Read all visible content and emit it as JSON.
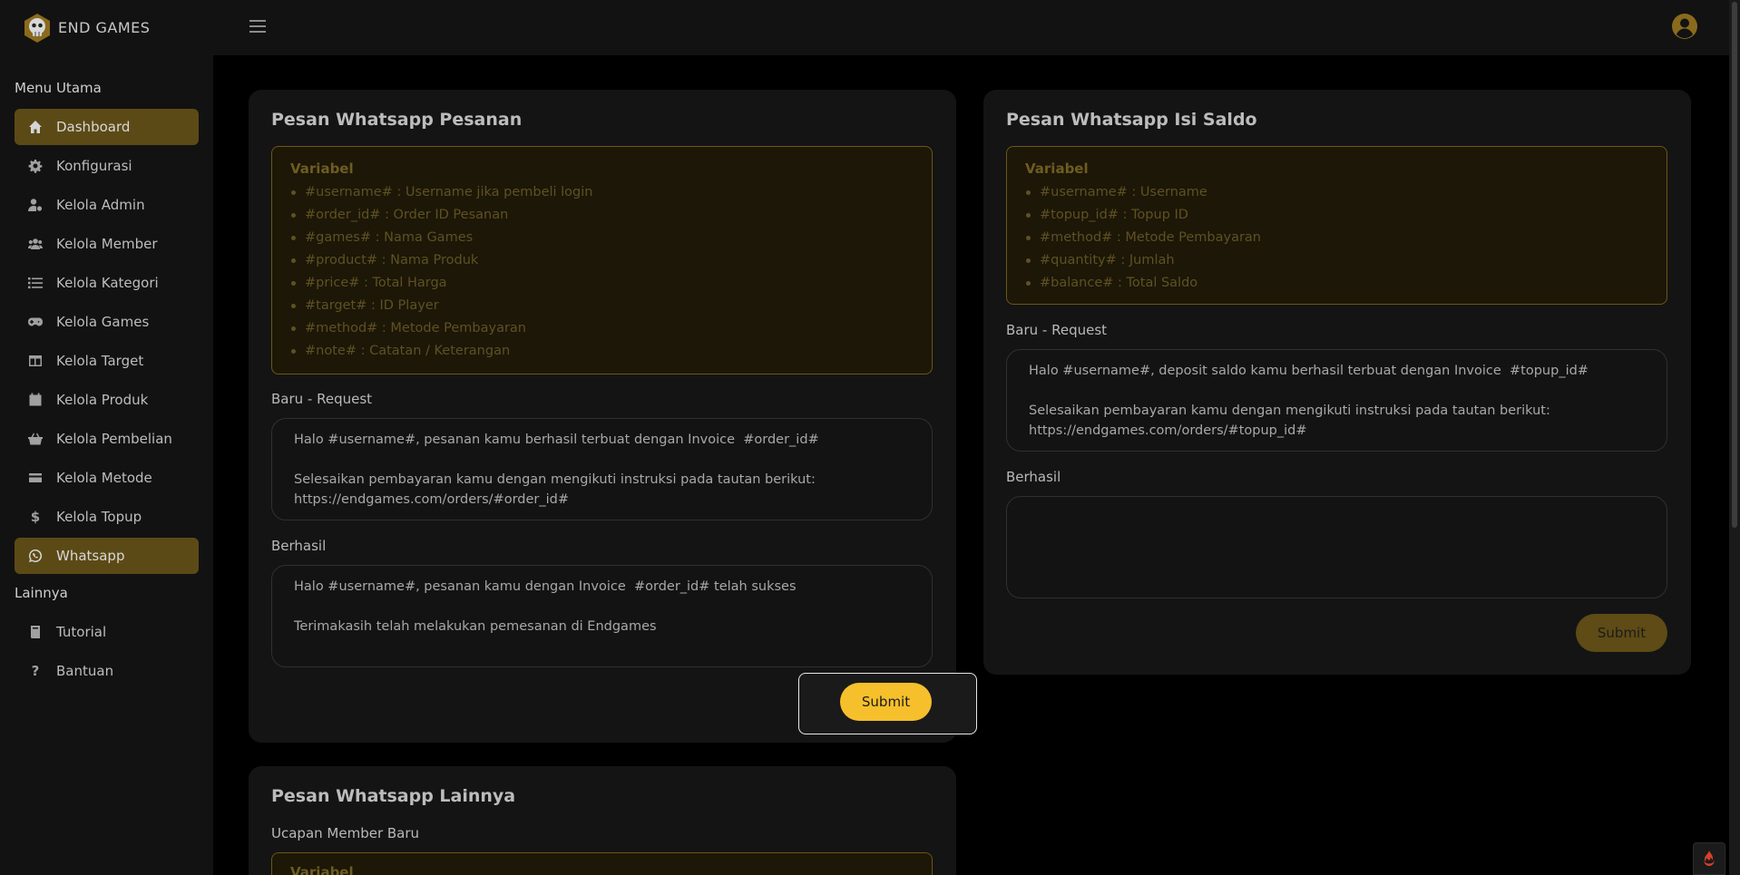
{
  "brand": {
    "name": "END GAMES"
  },
  "sidebar": {
    "main_label": "Menu Utama",
    "items": [
      {
        "label": "Dashboard",
        "icon": "home-icon"
      },
      {
        "label": "Konfigurasi",
        "icon": "gear-icon"
      },
      {
        "label": "Kelola Admin",
        "icon": "user-cog-icon"
      },
      {
        "label": "Kelola Member",
        "icon": "users-icon"
      },
      {
        "label": "Kelola Kategori",
        "icon": "list-icon"
      },
      {
        "label": "Kelola Games",
        "icon": "gamepad-icon"
      },
      {
        "label": "Kelola Target",
        "icon": "table-icon"
      },
      {
        "label": "Kelola Produk",
        "icon": "calendar-icon"
      },
      {
        "label": "Kelola Pembelian",
        "icon": "basket-icon"
      },
      {
        "label": "Kelola Metode",
        "icon": "credit-card-icon"
      },
      {
        "label": "Kelola Topup",
        "icon": "dollar-icon"
      },
      {
        "label": "Whatsapp",
        "icon": "whatsapp-icon"
      }
    ],
    "other_label": "Lainnya",
    "other_items": [
      {
        "label": "Tutorial",
        "icon": "book-icon"
      },
      {
        "label": "Bantuan",
        "icon": "question-icon"
      }
    ]
  },
  "order_card": {
    "title": "Pesan Whatsapp Pesanan",
    "variables_title": "Variabel",
    "variables": [
      "#username# : Username jika pembeli login",
      "#order_id# : Order ID Pesanan",
      "#games# : Nama Games",
      "#product# : Nama Produk",
      "#price# : Total Harga",
      "#target# : ID Player",
      "#method# : Metode Pembayaran",
      "#note# : Catatan / Keterangan"
    ],
    "request_label": "Baru - Request",
    "request_value": "Halo #username#, pesanan kamu berhasil terbuat dengan Invoice  #order_id#\n\nSelesaikan pembayaran kamu dengan mengikuti instruksi pada tautan berikut:\nhttps://endgames.com/orders/#order_id#",
    "success_label": "Berhasil",
    "success_value": "Halo #username#, pesanan kamu dengan Invoice  #order_id# telah sukses\n\nTerimakasih telah melakukan pemesanan di Endgames",
    "submit_label": "Submit"
  },
  "topup_card": {
    "title": "Pesan Whatsapp Isi Saldo",
    "variables_title": "Variabel",
    "variables": [
      "#username# : Username",
      "#topup_id# : Topup ID",
      "#method# : Metode Pembayaran",
      "#quantity# : Jumlah",
      "#balance# : Total Saldo"
    ],
    "request_label": "Baru - Request",
    "request_value": "Halo #username#, deposit saldo kamu berhasil terbuat dengan Invoice  #topup_id#\n\nSelesaikan pembayaran kamu dengan mengikuti instruksi pada tautan berikut:\nhttps://endgames.com/orders/#topup_id#",
    "success_label": "Berhasil",
    "success_value": "",
    "submit_label": "Submit"
  },
  "other_card": {
    "title": "Pesan Whatsapp Lainnya",
    "new_member_label": "Ucapan Member Baru",
    "variables_title": "Variabel"
  },
  "colors": {
    "accent": "#f6c02c",
    "accent_dim": "#5e4b15",
    "background": "#000000",
    "panel": "#141414"
  }
}
